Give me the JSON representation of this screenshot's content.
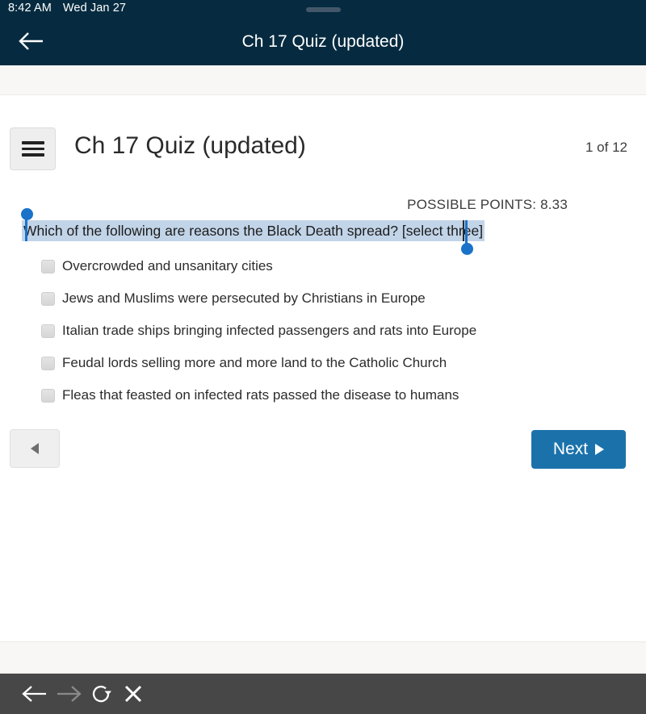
{
  "status_bar": {
    "time": "8:42 AM",
    "date": "Wed Jan 27",
    "drag_handle": "drag-handle"
  },
  "nav_bar": {
    "back_icon": "arrow-left-icon",
    "title": "Ch 17 Quiz (updated)"
  },
  "quiz": {
    "menu_icon": "hamburger-menu-icon",
    "title": "Ch 17 Quiz (updated)",
    "pager": "1 of 12",
    "possible_points": "POSSIBLE POINTS: 8.33",
    "question": "Which of the following are reasons the Black Death spread? [select three]",
    "question_selected": true,
    "choices": [
      {
        "label": "Overcrowded and unsanitary cities",
        "checked": false
      },
      {
        "label": "Jews and Muslims were persecuted by Christians in Europe",
        "checked": false
      },
      {
        "label": "Italian trade ships bringing infected passengers and rats into Europe",
        "checked": false
      },
      {
        "label": "Feudal lords selling more and more land to the Catholic Church",
        "checked": false
      },
      {
        "label": "Fleas that feasted on infected rats passed the disease to humans",
        "checked": false
      }
    ],
    "prev_button": {
      "icon": "triangle-left-icon"
    },
    "next_button": {
      "label": "Next",
      "icon": "triangle-right-icon"
    }
  },
  "browser_toolbar": {
    "back_icon": "arrow-left-icon",
    "forward_icon": "arrow-right-icon",
    "reload_icon": "reload-icon",
    "close_icon": "close-x-icon"
  },
  "colors": {
    "navy_chrome": "#062b40",
    "accent_blue": "#1b72ab",
    "selection_blue": "#c2d4e8",
    "handle_blue": "#1a73c8",
    "toolbar_gray": "#474747",
    "strip_gray": "#f8f7f5"
  }
}
